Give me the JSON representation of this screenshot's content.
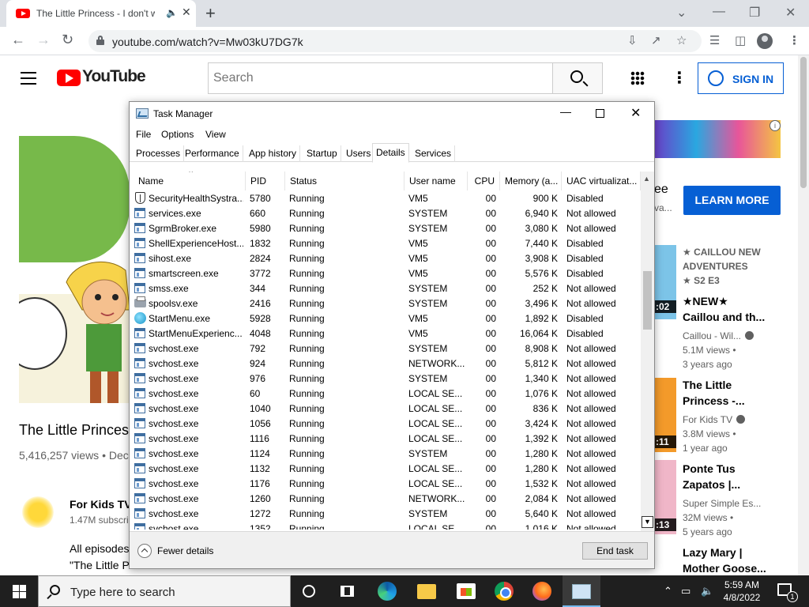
{
  "browser": {
    "tab_title": "The Little Princess - I don't w",
    "audio_icon": "speaker-icon",
    "url": "youtube.com/watch?v=Mw03kU7DG7k"
  },
  "youtube": {
    "logo_text": "YouTube",
    "search_placeholder": "Search",
    "sign_in": "SIGN IN",
    "video": {
      "title": "The Little Princess",
      "views": "5,416,257 views • Dec"
    },
    "channel": {
      "name": "For Kids TV",
      "subs": "1.47M subscri"
    },
    "description": [
      "All episodes",
      "\"The Little P"
    ],
    "ad": {
      "fragment": "ee",
      "fragment2": "va...",
      "learn_more": "LEARN MORE"
    },
    "recommendations": [
      {
        "badge": "★ CAILLOU NEW",
        "badge2": "ADVENTURES",
        "badge3": "★  S2 E3",
        "time": ""
      },
      {
        "title1": "★NEW★",
        "title2": "Caillou and th...",
        "channel": "Caillou - Wil...",
        "views": "5.1M views •",
        "age": "3 years ago",
        "time": ":02"
      },
      {
        "title1": "The Little",
        "title2": "Princess -...",
        "channel": "For Kids TV",
        "views": "3.8M views •",
        "age": "1 year ago",
        "time": ":11"
      },
      {
        "title1": "Ponte Tus",
        "title2": "Zapatos |...",
        "channel": "Super Simple Es...",
        "views": "32M views •",
        "age": "5 years ago",
        "time": ":13"
      },
      {
        "title1": "Lazy Mary |",
        "title2": "Mother Goose..."
      }
    ]
  },
  "task_manager": {
    "title": "Task Manager",
    "menu": [
      "File",
      "Options",
      "View"
    ],
    "tabs": [
      "Processes",
      "Performance",
      "App history",
      "Startup",
      "Users",
      "Details",
      "Services"
    ],
    "active_tab": "Details",
    "columns": [
      "Name",
      "PID",
      "Status",
      "User name",
      "CPU",
      "Memory (a...",
      "UAC virtualizat..."
    ],
    "rows": [
      {
        "icon": "shield",
        "name": "SecurityHealthSystra...",
        "pid": "5780",
        "status": "Running",
        "user": "VM5",
        "cpu": "00",
        "mem": "900 K",
        "uac": "Disabled"
      },
      {
        "icon": "app",
        "name": "services.exe",
        "pid": "660",
        "status": "Running",
        "user": "SYSTEM",
        "cpu": "00",
        "mem": "6,940 K",
        "uac": "Not allowed"
      },
      {
        "icon": "app",
        "name": "SgrmBroker.exe",
        "pid": "5980",
        "status": "Running",
        "user": "SYSTEM",
        "cpu": "00",
        "mem": "3,080 K",
        "uac": "Not allowed"
      },
      {
        "icon": "app",
        "name": "ShellExperienceHost....",
        "pid": "1832",
        "status": "Running",
        "user": "VM5",
        "cpu": "00",
        "mem": "7,440 K",
        "uac": "Disabled"
      },
      {
        "icon": "app",
        "name": "sihost.exe",
        "pid": "2824",
        "status": "Running",
        "user": "VM5",
        "cpu": "00",
        "mem": "3,908 K",
        "uac": "Disabled"
      },
      {
        "icon": "app",
        "name": "smartscreen.exe",
        "pid": "3772",
        "status": "Running",
        "user": "VM5",
        "cpu": "00",
        "mem": "5,576 K",
        "uac": "Disabled"
      },
      {
        "icon": "app",
        "name": "smss.exe",
        "pid": "344",
        "status": "Running",
        "user": "SYSTEM",
        "cpu": "00",
        "mem": "252 K",
        "uac": "Not allowed"
      },
      {
        "icon": "printer",
        "name": "spoolsv.exe",
        "pid": "2416",
        "status": "Running",
        "user": "SYSTEM",
        "cpu": "00",
        "mem": "3,496 K",
        "uac": "Not allowed"
      },
      {
        "icon": "globe",
        "name": "StartMenu.exe",
        "pid": "5928",
        "status": "Running",
        "user": "VM5",
        "cpu": "00",
        "mem": "1,892 K",
        "uac": "Disabled"
      },
      {
        "icon": "app",
        "name": "StartMenuExperienc...",
        "pid": "4048",
        "status": "Running",
        "user": "VM5",
        "cpu": "00",
        "mem": "16,064 K",
        "uac": "Disabled"
      },
      {
        "icon": "app",
        "name": "svchost.exe",
        "pid": "792",
        "status": "Running",
        "user": "SYSTEM",
        "cpu": "00",
        "mem": "8,908 K",
        "uac": "Not allowed"
      },
      {
        "icon": "app",
        "name": "svchost.exe",
        "pid": "924",
        "status": "Running",
        "user": "NETWORK...",
        "cpu": "00",
        "mem": "5,812 K",
        "uac": "Not allowed"
      },
      {
        "icon": "app",
        "name": "svchost.exe",
        "pid": "976",
        "status": "Running",
        "user": "SYSTEM",
        "cpu": "00",
        "mem": "1,340 K",
        "uac": "Not allowed"
      },
      {
        "icon": "app",
        "name": "svchost.exe",
        "pid": "60",
        "status": "Running",
        "user": "LOCAL SE...",
        "cpu": "00",
        "mem": "1,076 K",
        "uac": "Not allowed"
      },
      {
        "icon": "app",
        "name": "svchost.exe",
        "pid": "1040",
        "status": "Running",
        "user": "LOCAL SE...",
        "cpu": "00",
        "mem": "836 K",
        "uac": "Not allowed"
      },
      {
        "icon": "app",
        "name": "svchost.exe",
        "pid": "1056",
        "status": "Running",
        "user": "LOCAL SE...",
        "cpu": "00",
        "mem": "3,424 K",
        "uac": "Not allowed"
      },
      {
        "icon": "app",
        "name": "svchost.exe",
        "pid": "1116",
        "status": "Running",
        "user": "LOCAL SE...",
        "cpu": "00",
        "mem": "1,392 K",
        "uac": "Not allowed"
      },
      {
        "icon": "app",
        "name": "svchost.exe",
        "pid": "1124",
        "status": "Running",
        "user": "SYSTEM",
        "cpu": "00",
        "mem": "1,280 K",
        "uac": "Not allowed"
      },
      {
        "icon": "app",
        "name": "svchost.exe",
        "pid": "1132",
        "status": "Running",
        "user": "LOCAL SE...",
        "cpu": "00",
        "mem": "1,280 K",
        "uac": "Not allowed"
      },
      {
        "icon": "app",
        "name": "svchost.exe",
        "pid": "1176",
        "status": "Running",
        "user": "LOCAL SE...",
        "cpu": "00",
        "mem": "1,532 K",
        "uac": "Not allowed"
      },
      {
        "icon": "app",
        "name": "svchost.exe",
        "pid": "1260",
        "status": "Running",
        "user": "NETWORK...",
        "cpu": "00",
        "mem": "2,084 K",
        "uac": "Not allowed"
      },
      {
        "icon": "app",
        "name": "svchost.exe",
        "pid": "1272",
        "status": "Running",
        "user": "SYSTEM",
        "cpu": "00",
        "mem": "5,640 K",
        "uac": "Not allowed"
      },
      {
        "icon": "app",
        "name": "svchost.exe",
        "pid": "1352",
        "status": "Running",
        "user": "LOCAL SE...",
        "cpu": "00",
        "mem": "1,016 K",
        "uac": "Not allowed"
      }
    ],
    "fewer_details": "Fewer details",
    "end_task": "End task"
  },
  "taskbar": {
    "search_placeholder": "Type here to search",
    "time": "5:59 AM",
    "date": "4/8/2022",
    "notification_count": "1"
  }
}
